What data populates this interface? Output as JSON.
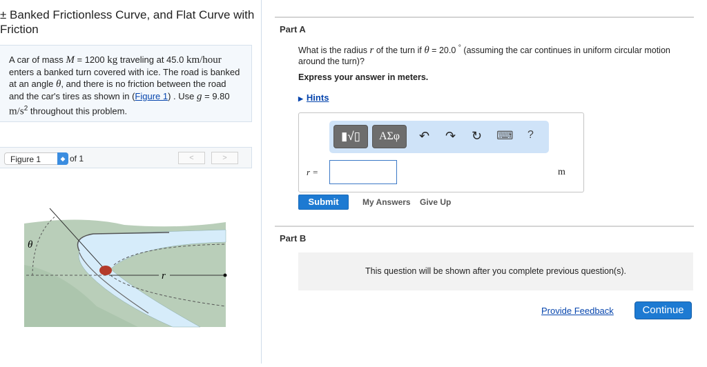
{
  "title": "± Banked Frictionless Curve, and Flat Curve with Friction",
  "problem": {
    "p1": "A car of mass ",
    "M": "M",
    "p2": " = 1200 ",
    "kg": "kg",
    "p3": " traveling at 45.0 ",
    "kmh": "km/hour",
    "p4": " enters a banked turn covered with ice. The road is banked at an angle ",
    "theta": "θ",
    "p5": ", and there is no friction between the road and the car's tires as shown in (",
    "fig_link": "Figure 1",
    "p6": ") . Use ",
    "g": "g",
    "p7": " = 9.80 ",
    "ms": "m/s",
    "sq": "2",
    "p8": " throughout this problem."
  },
  "figure": {
    "select": "Figure 1",
    "of": "of 1",
    "prev": "<",
    "next": ">",
    "theta_label": "θ",
    "r_label": "r"
  },
  "partA": {
    "header": "Part A",
    "q1": "What is the radius ",
    "r": "r",
    "q2": " of the turn if ",
    "theta": "θ",
    "q3": " = 20.0 ",
    "deg": "°",
    "q4": " (assuming the car continues in uniform circular motion around the turn)?",
    "express": "Express your answer in meters.",
    "hints": "Hints",
    "toolbar": {
      "templates": "▮√▯",
      "greek": "ΑΣφ",
      "undo": "↶",
      "redo": "↷",
      "reset": "↻",
      "keyboard": "⌨",
      "help": "?"
    },
    "var_label": "r =",
    "input_value": "",
    "unit": "m",
    "submit": "Submit",
    "my_answers": "My Answers",
    "give_up": "Give Up"
  },
  "partB": {
    "header": "Part B",
    "message": "This question will be shown after you complete previous question(s)."
  },
  "footer": {
    "feedback": "Provide Feedback",
    "continue": "Continue"
  }
}
